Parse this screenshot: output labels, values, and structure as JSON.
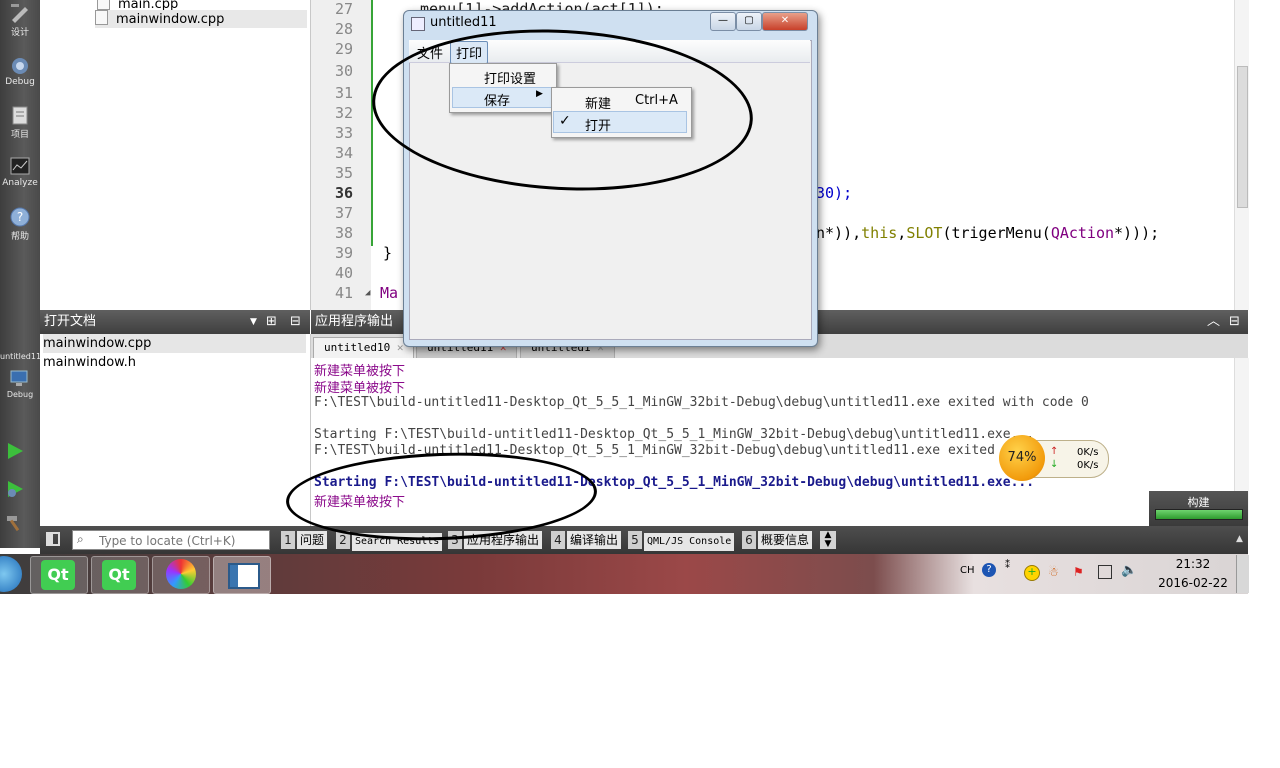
{
  "modebar": {
    "items": [
      {
        "label": "设计"
      },
      {
        "label": "Debug"
      },
      {
        "label": "项目"
      },
      {
        "label": "Analyze"
      },
      {
        "label": "帮助"
      }
    ],
    "kit_label": "untitled11",
    "kit_mode": "Debug"
  },
  "project_tree": {
    "files": [
      "main.cpp",
      "mainwindow.cpp"
    ]
  },
  "open_docs": {
    "title": "打开文档",
    "items": [
      "mainwindow.cpp",
      "mainwindow.h"
    ]
  },
  "editor": {
    "line_numbers": [
      "27",
      "28",
      "29",
      "30",
      "31",
      "32",
      "33",
      "34",
      "35",
      "36",
      "37",
      "38",
      "39",
      "40",
      "41"
    ],
    "lines": {
      "l27": "menu[1]->addAction(act[1]);",
      "l36_tail": "30);",
      "l38_tail": "n*)),",
      "l38_this": "this",
      "l38_comma": ",",
      "l38_slot": "SLOT",
      "l38_mid": "(trigerMenu(",
      "l38_qaction": "QAction",
      "l38_end": "*)));",
      "l39": "}",
      "l41": "Ma"
    }
  },
  "output": {
    "title": "应用程序输出",
    "tabs": [
      "untitled10",
      "untitled11",
      "untitled1"
    ],
    "lines": [
      "新建菜单被按下",
      "新建菜单被按下",
      "F:\\TEST\\build-untitled11-Desktop_Qt_5_5_1_MinGW_32bit-Debug\\debug\\untitled11.exe exited with code 0",
      "",
      "Starting F:\\TEST\\build-untitled11-Desktop_Qt_5_5_1_MinGW_32bit-Debug\\debug\\untitled11.exe...",
      "F:\\TEST\\build-untitled11-Desktop_Qt_5_5_1_MinGW_32bit-Debug\\debug\\untitled11.exe exited",
      "",
      "Starting F:\\TEST\\build-untitled11-Desktop_Qt_5_5_1_MinGW_32bit-Debug\\debug\\untitled11.exe...",
      "新建菜单被按下"
    ]
  },
  "build": {
    "label": "构建",
    "progress": 1.0
  },
  "network_widget": {
    "cpu_percent": "74%",
    "up": "0K/s",
    "down": "0K/s"
  },
  "locator": {
    "placeholder": "Type to locate (Ctrl+K)",
    "panes": [
      {
        "num": "1",
        "label": "问题"
      },
      {
        "num": "2",
        "label": "Search Results"
      },
      {
        "num": "3",
        "label": "应用程序输出"
      },
      {
        "num": "4",
        "label": "编译输出"
      },
      {
        "num": "5",
        "label": "QML/JS Console"
      },
      {
        "num": "6",
        "label": "概要信息"
      }
    ]
  },
  "window": {
    "title": "untitled11",
    "menus": [
      "文件",
      "打印"
    ],
    "print_menu": [
      "打印设置",
      "保存"
    ],
    "save_submenu": [
      {
        "label": "新建",
        "shortcut": "Ctrl+A",
        "checked": false
      },
      {
        "label": "打开",
        "shortcut": "",
        "checked": true
      }
    ]
  },
  "tray": {
    "lang": "CH",
    "time": "21:32",
    "date": "2016-02-22"
  },
  "colors": {
    "accent_output_blue": "#1a1a8c",
    "purple_text": "#8b0a8b",
    "build_green": "#3aa53a",
    "selection_blue": "#cde4f7"
  }
}
